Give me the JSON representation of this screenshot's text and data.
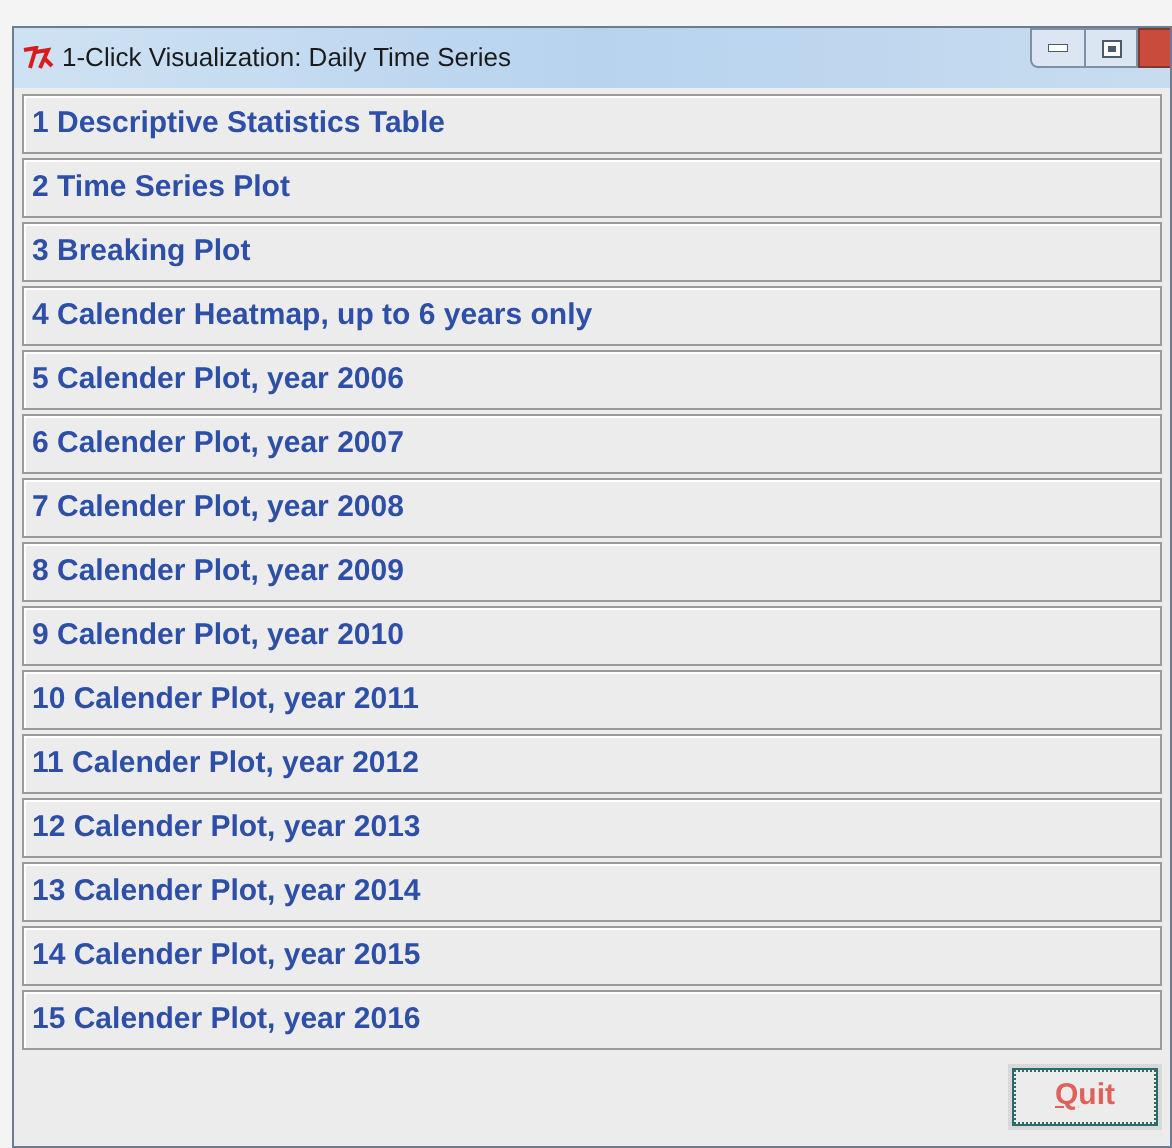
{
  "window": {
    "title": "1-Click Visualization: Daily Time Series"
  },
  "options": [
    {
      "label": "1 Descriptive Statistics Table"
    },
    {
      "label": "2 Time Series Plot"
    },
    {
      "label": "3 Breaking Plot"
    },
    {
      "label": "4 Calender Heatmap, up to 6 years only"
    },
    {
      "label": "5 Calender Plot, year 2006"
    },
    {
      "label": "6 Calender Plot, year 2007"
    },
    {
      "label": "7 Calender Plot, year 2008"
    },
    {
      "label": "8 Calender Plot, year 2009"
    },
    {
      "label": "9 Calender Plot, year 2010"
    },
    {
      "label": "10 Calender Plot, year 2011"
    },
    {
      "label": "11 Calender Plot, year 2012"
    },
    {
      "label": "12 Calender Plot, year 2013"
    },
    {
      "label": "13 Calender Plot, year 2014"
    },
    {
      "label": "14 Calender Plot, year 2015"
    },
    {
      "label": "15 Calender Plot, year 2016"
    }
  ],
  "quit_button": {
    "label": "Quit",
    "mnemonic_underline": true,
    "focused": true
  }
}
